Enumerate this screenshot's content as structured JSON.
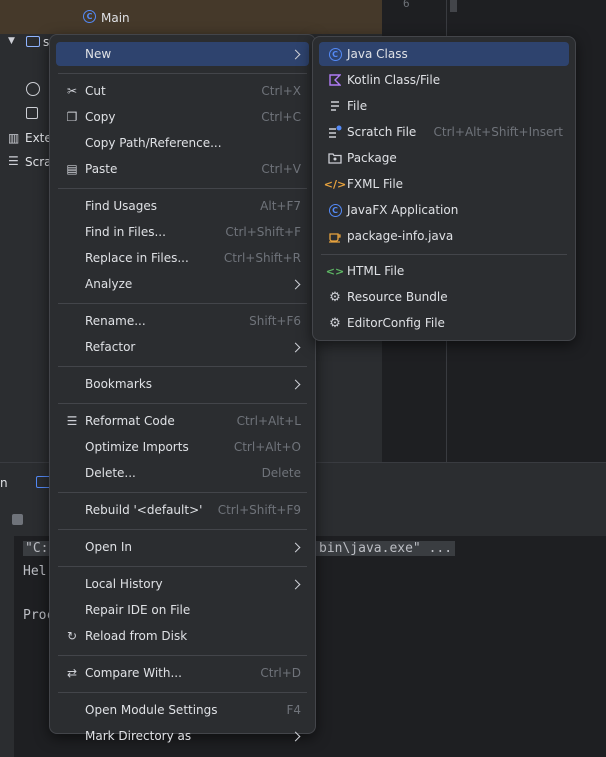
{
  "project_tree": {
    "main_file": "Main",
    "src_label": "s",
    "external_label": "Exter",
    "scratches_label": "Scrat",
    "line_number": "6"
  },
  "run_panel": {
    "tab_label": "n",
    "console_lines": [
      "\"C:",
      "Hel",
      "",
      "Proc"
    ],
    "command_tail": "bin\\java.exe\" ..."
  },
  "context_menu": {
    "items": [
      {
        "label": "New",
        "submenu": true,
        "selected": true
      },
      {
        "sep": true
      },
      {
        "label": "Cut",
        "shortcut": "Ctrl+X",
        "icon": "scissors-icon"
      },
      {
        "label": "Copy",
        "shortcut": "Ctrl+C",
        "icon": "copy-icon"
      },
      {
        "label": "Copy Path/Reference..."
      },
      {
        "label": "Paste",
        "shortcut": "Ctrl+V",
        "icon": "paste-icon"
      },
      {
        "sep": true
      },
      {
        "label": "Find Usages",
        "shortcut": "Alt+F7"
      },
      {
        "label": "Find in Files...",
        "shortcut": "Ctrl+Shift+F"
      },
      {
        "label": "Replace in Files...",
        "shortcut": "Ctrl+Shift+R"
      },
      {
        "label": "Analyze",
        "submenu": true
      },
      {
        "sep": true
      },
      {
        "label": "Rename...",
        "shortcut": "Shift+F6"
      },
      {
        "label": "Refactor",
        "submenu": true
      },
      {
        "sep": true
      },
      {
        "label": "Bookmarks",
        "submenu": true
      },
      {
        "sep": true
      },
      {
        "label": "Reformat Code",
        "shortcut": "Ctrl+Alt+L",
        "icon": "reformat-icon"
      },
      {
        "label": "Optimize Imports",
        "shortcut": "Ctrl+Alt+O"
      },
      {
        "label": "Delete...",
        "shortcut": "Delete"
      },
      {
        "sep": true
      },
      {
        "label": "Rebuild '<default>'",
        "shortcut": "Ctrl+Shift+F9"
      },
      {
        "sep": true
      },
      {
        "label": "Open In",
        "submenu": true
      },
      {
        "sep": true
      },
      {
        "label": "Local History",
        "submenu": true
      },
      {
        "label": "Repair IDE on File"
      },
      {
        "label": "Reload from Disk",
        "icon": "reload-icon"
      },
      {
        "sep": true
      },
      {
        "label": "Compare With...",
        "shortcut": "Ctrl+D",
        "icon": "compare-icon"
      },
      {
        "sep": true
      },
      {
        "label": "Open Module Settings",
        "shortcut": "F4"
      },
      {
        "label": "Mark Directory as",
        "submenu": true
      }
    ]
  },
  "new_submenu": {
    "items": [
      {
        "label": "Java Class",
        "icon": "java-class-icon",
        "selected": true
      },
      {
        "label": "Kotlin Class/File",
        "icon": "kotlin-icon"
      },
      {
        "label": "File",
        "icon": "file-icon"
      },
      {
        "label": "Scratch File",
        "shortcut": "Ctrl+Alt+Shift+Insert",
        "icon": "scratch-file-icon"
      },
      {
        "label": "Package",
        "icon": "package-icon"
      },
      {
        "label": "FXML File",
        "icon": "fxml-icon"
      },
      {
        "label": "JavaFX Application",
        "icon": "javafx-icon"
      },
      {
        "label": "package-info.java",
        "icon": "package-info-icon"
      },
      {
        "sep": true
      },
      {
        "label": "HTML File",
        "icon": "html-icon"
      },
      {
        "label": "Resource Bundle",
        "icon": "resource-bundle-icon"
      },
      {
        "label": "EditorConfig File",
        "icon": "editorconfig-icon"
      }
    ]
  },
  "colors": {
    "accent": "#2e436e",
    "menu_bg": "#2b2d30",
    "java_blue": "#548af7"
  }
}
